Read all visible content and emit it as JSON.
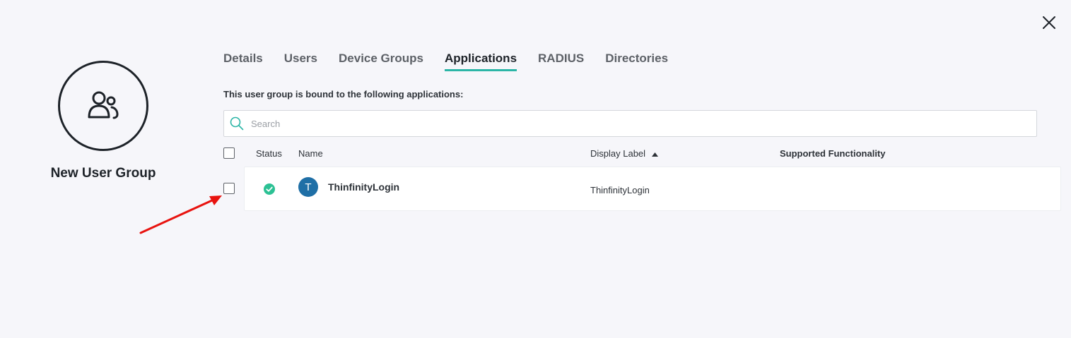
{
  "close": {
    "icon": "close-icon"
  },
  "group": {
    "icon": "users-group-icon",
    "name": "New User Group"
  },
  "tabs": [
    {
      "label": "Details",
      "active": false
    },
    {
      "label": "Users",
      "active": false
    },
    {
      "label": "Device Groups",
      "active": false
    },
    {
      "label": "Applications",
      "active": true
    },
    {
      "label": "RADIUS",
      "active": false
    },
    {
      "label": "Directories",
      "active": false
    }
  ],
  "content": {
    "description": "This user group is bound to the following applications:",
    "search": {
      "placeholder": "Search",
      "value": "",
      "icon": "search-icon"
    },
    "table": {
      "columns": {
        "status": "Status",
        "name": "Name",
        "display_label": "Display Label",
        "supported_functionality": "Supported Functionality"
      },
      "sort": {
        "column": "display_label",
        "direction": "ascending"
      },
      "rows": [
        {
          "checked": false,
          "status": "active",
          "avatar_letter": "T",
          "name": "ThinfinityLogin",
          "display_label": "ThinfinityLogin",
          "supported_functionality": ""
        }
      ]
    }
  },
  "colors": {
    "accent": "#2bb5a6",
    "status_ok": "#2cc194",
    "app_avatar": "#1f6fa6",
    "annotation_arrow": "#e8130f"
  }
}
